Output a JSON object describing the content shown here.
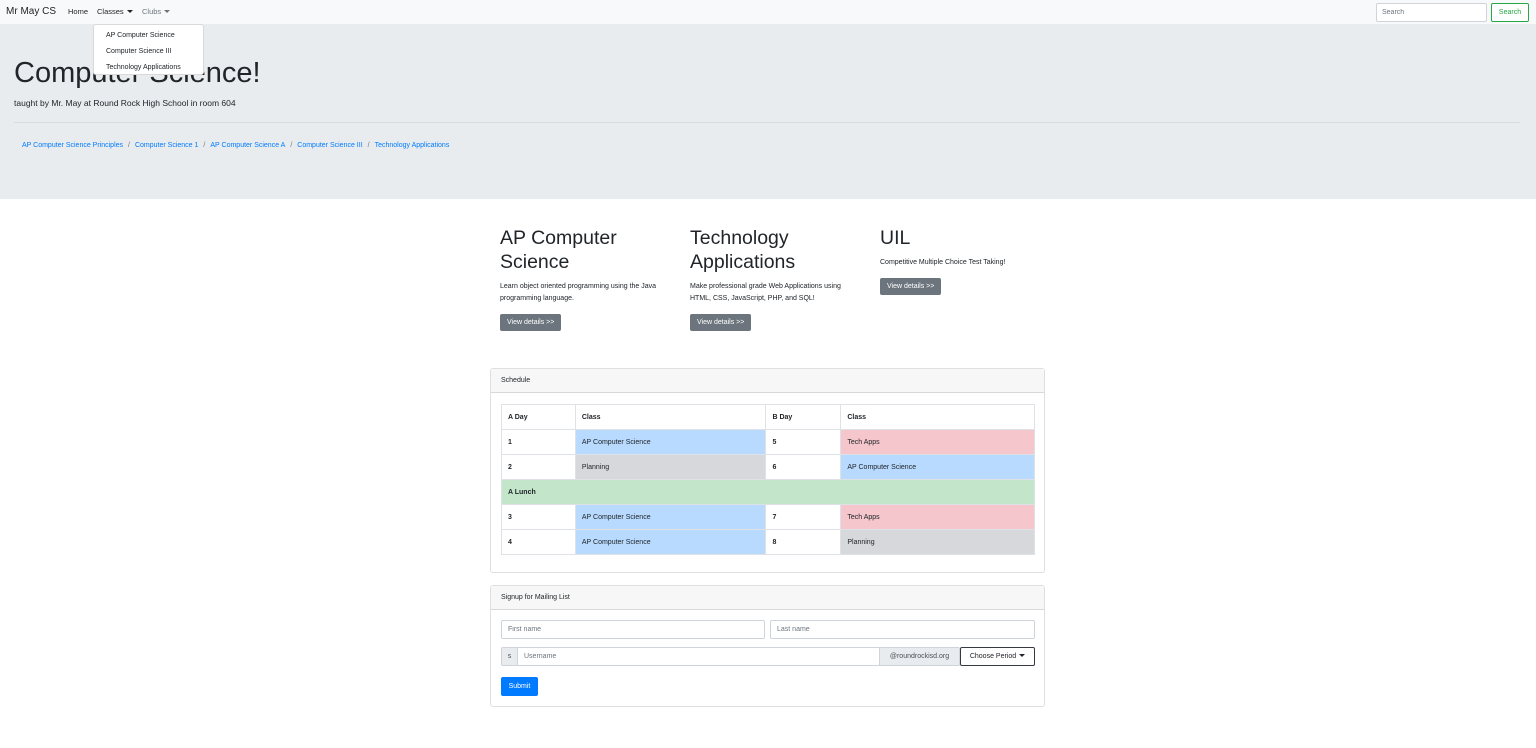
{
  "navbar": {
    "brand": "Mr May CS",
    "links": {
      "home": "Home",
      "classes": "Classes",
      "clubs": "Clubs"
    },
    "search_placeholder": "Search",
    "search_button": "Search"
  },
  "classes_dropdown": {
    "items": [
      "AP Computer Science",
      "Computer Science III",
      "Technology Applications"
    ]
  },
  "jumbotron": {
    "title": "Computer Science!",
    "lead": "taught by Mr. May at Round Rock High School in room 604",
    "breadcrumb": [
      "AP Computer Science Principles",
      "Computer Science 1",
      "AP Computer Science A",
      "Computer Science III",
      "Technology Applications"
    ],
    "breadcrumb_separator": "/"
  },
  "features": [
    {
      "title": "AP Computer Science",
      "text": "Learn object oriented programming using the Java programming language.",
      "button": "View details >>"
    },
    {
      "title": "Technology Applications",
      "text": "Make professional grade Web Applications using HTML, CSS, JavaScript, PHP, and SQL!",
      "button": "View details >>"
    },
    {
      "title": "UIL",
      "text": "Competitive Multiple Choice Test Taking!",
      "button": "View details >>"
    }
  ],
  "schedule": {
    "header": "Schedule",
    "columns": [
      "A Day",
      "Class",
      "B Day",
      "Class"
    ],
    "rows": [
      {
        "a": "1",
        "a_class": "AP Computer Science",
        "b": "5",
        "b_class": "Tech Apps"
      },
      {
        "a": "2",
        "a_class": "Planning",
        "b": "6",
        "b_class": "AP Computer Science"
      },
      {
        "lunch": "A Lunch"
      },
      {
        "a": "3",
        "a_class": "AP Computer Science",
        "b": "7",
        "b_class": "Tech Apps"
      },
      {
        "a": "4",
        "a_class": "AP Computer Science",
        "b": "8",
        "b_class": "Planning"
      }
    ],
    "colors": {
      "ap": "#b8daff",
      "tech": "#f5c6cb",
      "planning": "#d6d8db",
      "lunch": "#c3e6cb"
    }
  },
  "mailing": {
    "header": "Signup for Mailing List",
    "first_placeholder": "First name",
    "last_placeholder": "Last name",
    "prefix": "s",
    "username_placeholder": "Username",
    "domain": "@roundrockisd.org",
    "period_button": "Choose Period",
    "submit": "Submit"
  }
}
